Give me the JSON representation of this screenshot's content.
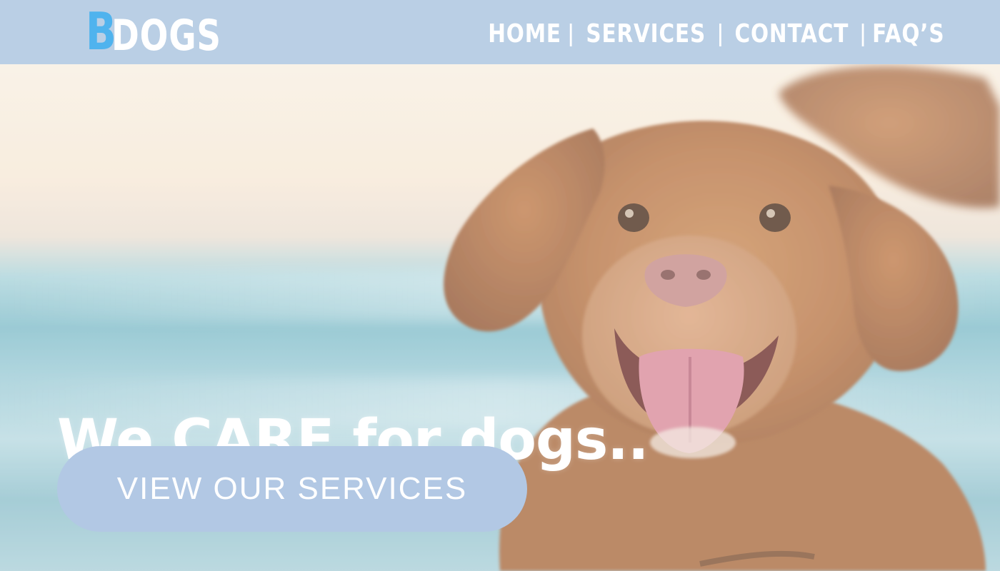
{
  "header": {
    "logo": {
      "initial": "B",
      "rest": "DOGS"
    },
    "nav": [
      {
        "label": "HOME"
      },
      {
        "label": "SERVICES"
      },
      {
        "label": "CONTACT"
      },
      {
        "label": "FAQ’S"
      }
    ],
    "separator": "|"
  },
  "hero": {
    "headline": "We CARE for dogs..",
    "cta_label": "VIEW OUR SERVICES"
  },
  "colors": {
    "header_bg": "#bacfe5",
    "logo_accent": "#4fb3ee",
    "cta_bg": "#b2c8e4",
    "text": "#ffffff"
  }
}
